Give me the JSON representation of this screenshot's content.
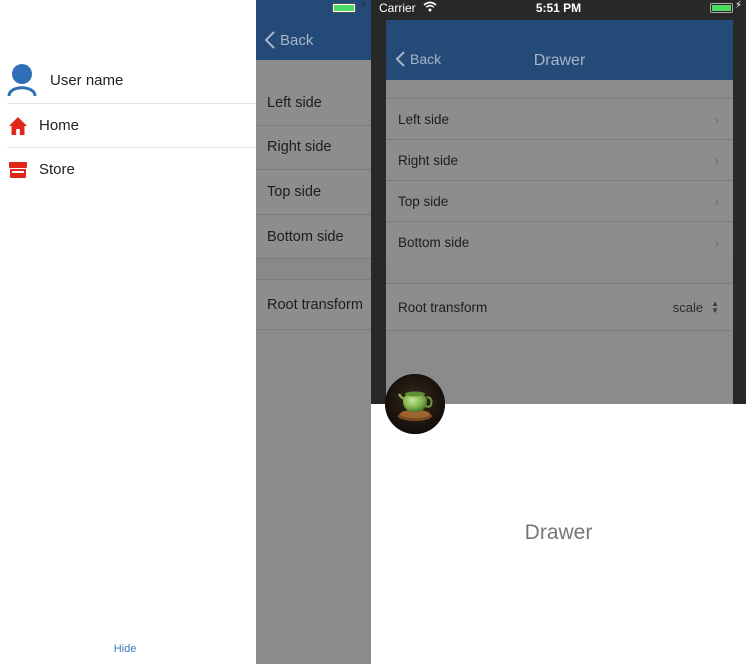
{
  "menu": {
    "user_name": "User name",
    "items": [
      {
        "label": "Home",
        "icon": "home-icon",
        "color": "#e0251b"
      },
      {
        "label": "Store",
        "icon": "store-icon",
        "color": "#e0251b"
      }
    ],
    "hide_label": "Hide",
    "user_icon_color": "#2f6fb5"
  },
  "left_content": {
    "back_label": "Back",
    "rows": [
      "Left side",
      "Right side",
      "Top side",
      "Bottom side"
    ],
    "root_label": "Root transform"
  },
  "status_bar": {
    "carrier": "Carrier",
    "time": "5:51 PM"
  },
  "right_content": {
    "back_label": "Back",
    "title": "Drawer",
    "rows": [
      "Left side",
      "Right side",
      "Top side",
      "Bottom side"
    ],
    "root_label": "Root transform",
    "root_value": "scale"
  },
  "bottom_drawer": {
    "label": "Drawer"
  },
  "colors": {
    "nav_bar": "#244a78",
    "accent_red": "#e0251b",
    "link_blue": "#3b7ab8"
  }
}
